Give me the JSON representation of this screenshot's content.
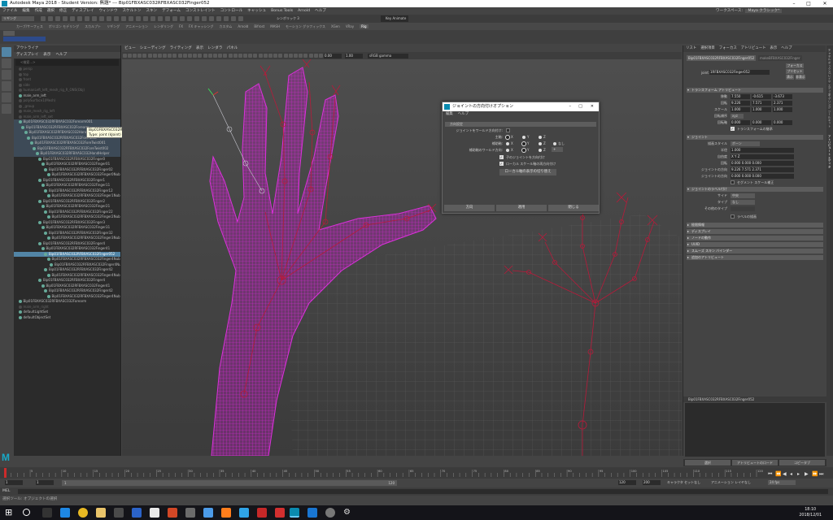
{
  "window": {
    "title": "Autodesk Maya 2018 - Student Version: 無題* --- Bip01FBXASC032RFBXASC032Finger052",
    "controls": [
      "–",
      "□",
      "✕"
    ]
  },
  "menubar": [
    "ファイル",
    "編集",
    "作成",
    "選択",
    "修正",
    "ディスプレイ",
    "ウィンドウ",
    "スケルトン",
    "スキン",
    "デフォーム",
    "コンストレイント",
    "コントロール",
    "キャッシュ",
    "Bonus Tools",
    "Arnold",
    "ヘルプ"
  ],
  "workspace": {
    "label": "ワークスペース:",
    "value": "Maya クラシック*"
  },
  "mode_dropdown": "リギング",
  "toolbar": {
    "live_surface": "シンボリック 3",
    "key_anim": "Key Animate"
  },
  "shelf_tabs": [
    "カーブ/サーフェス",
    "ポリゴン モデリング",
    "スカルプト",
    "リギング",
    "アニメーション",
    "レンダリング",
    "FX",
    "FX キャッシング",
    "カスタム",
    "Arnold",
    "Bifrost",
    "MASH",
    "モーション グラフィックス",
    "XGen",
    "VRay",
    "Rig"
  ],
  "outliner": {
    "title": "アウトライナ",
    "menu": [
      "ディスプレイ",
      "表示",
      "ヘルプ"
    ],
    "search_placeholder": "<検索...>",
    "items": [
      {
        "label": "persp",
        "depth": 1,
        "state": "dim"
      },
      {
        "label": "top",
        "depth": 1,
        "state": "dim"
      },
      {
        "label": "front",
        "depth": 1,
        "state": "dim"
      },
      {
        "label": "side",
        "depth": 1,
        "state": "dim"
      },
      {
        "label": "humanLeft_left_mesh_rig_R_ONS(Obj)",
        "depth": 1,
        "state": "dim"
      },
      {
        "label": "male_arm_left",
        "depth": 1,
        "state": "normal"
      },
      {
        "label": "polySurface1(Mesh)",
        "depth": 1,
        "state": "dim"
      },
      {
        "label": "_group",
        "depth": 1,
        "state": "dim"
      },
      {
        "label": "male_mesh_rig_left",
        "depth": 1,
        "state": "dim"
      },
      {
        "label": "male_arm_left_set",
        "depth": 1,
        "state": "dim"
      },
      {
        "label": "Bip01FBXASC032RFBXASC032Forearm001",
        "depth": 1,
        "state": "hl"
      },
      {
        "label": "Bip01FBXASC032RFBXASC032Forearm",
        "depth": 2,
        "state": "hl"
      },
      {
        "label": "Bip01FBXASC032RFBXASC032Hand",
        "depth": 3,
        "state": "hl"
      },
      {
        "label": "Bip01FBXASC032RFBXASC032ForeTwist",
        "depth": 4,
        "state": "hl"
      },
      {
        "label": "Bip01FBXASC032RFBXASC032ForeTwist001",
        "depth": 5,
        "state": "hl"
      },
      {
        "label": "Bip01FBXASC032RFBXASC032ForeTwist002",
        "depth": 6,
        "state": "hl"
      },
      {
        "label": "Bip01FBXASC032RFBXASC032HandHelper",
        "depth": 7,
        "state": "hl"
      },
      {
        "label": "Bip01FBXASC032RFBXASC032Finger0",
        "depth": 8,
        "state": "normal"
      },
      {
        "label": "Bip01FBXASC032RFBXASC032Finger01",
        "depth": 9,
        "state": "normal"
      },
      {
        "label": "Bip01FBXASC032RFBXASC032Finger02",
        "depth": 10,
        "state": "normal"
      },
      {
        "label": "Bip01FBXASC032RFBXASC032Finger0Nub",
        "depth": 11,
        "state": "normal"
      },
      {
        "label": "Bip01FBXASC032RFBXASC032Finger1",
        "depth": 8,
        "state": "normal"
      },
      {
        "label": "Bip01FBXASC032RFBXASC032Finger11",
        "depth": 9,
        "state": "normal"
      },
      {
        "label": "Bip01FBXASC032RFBXASC032Finger12",
        "depth": 10,
        "state": "normal"
      },
      {
        "label": "Bip01FBXASC032RFBXASC032Finger1Nub",
        "depth": 11,
        "state": "normal"
      },
      {
        "label": "Bip01FBXASC032RFBXASC032Finger2",
        "depth": 8,
        "state": "normal"
      },
      {
        "label": "Bip01FBXASC032RFBXASC032Finger21",
        "depth": 9,
        "state": "normal"
      },
      {
        "label": "Bip01FBXASC032RFBXASC032Finger22",
        "depth": 10,
        "state": "normal"
      },
      {
        "label": "Bip01FBXASC032RFBXASC032Finger2Nub",
        "depth": 11,
        "state": "normal"
      },
      {
        "label": "Bip01FBXASC032RFBXASC032Finger3",
        "depth": 8,
        "state": "normal"
      },
      {
        "label": "Bip01FBXASC032RFBXASC032Finger31",
        "depth": 9,
        "state": "normal"
      },
      {
        "label": "Bip01FBXASC032RFBXASC032Finger32",
        "depth": 10,
        "state": "normal"
      },
      {
        "label": "Bip01FBXASC032RFBXASC032Finger3Nub",
        "depth": 11,
        "state": "normal"
      },
      {
        "label": "Bip01FBXASC032RFBXASC032Finger4",
        "depth": 8,
        "state": "normal"
      },
      {
        "label": "Bip01FBXASC032RFBXASC032Finger41",
        "depth": 9,
        "state": "normal"
      },
      {
        "label": "Bip01FBXASC032RFBXASC032Finger052",
        "depth": 10,
        "state": "sel"
      },
      {
        "label": "Bip01FBXASC032RFBXASC032Finger4Nub",
        "depth": 11,
        "state": "normal"
      },
      {
        "label": "Bip01FBXASC032RFBXASC032Finger4Nub",
        "depth": 12,
        "state": "normal"
      },
      {
        "label": "Bip01FBXASC032RFBXASC032Finger42",
        "depth": 10,
        "state": "normal"
      },
      {
        "label": "Bip01FBXASC032RFBXASC032Finger4Nub",
        "depth": 11,
        "state": "normal"
      },
      {
        "label": "Bip01FBXASC032RFBXASC032Finger4",
        "depth": 8,
        "state": "normal"
      },
      {
        "label": "Bip01FBXASC032RFBXASC032Finger41",
        "depth": 9,
        "state": "normal"
      },
      {
        "label": "Bip01FBXASC032RFBXASC032Finger42",
        "depth": 10,
        "state": "normal"
      },
      {
        "label": "Bip01FBXASC032RFBXASC032Finger4Nub",
        "depth": 11,
        "state": "normal"
      },
      {
        "label": "Bip01FBXASC032RFBXASC032Forearm",
        "depth": 1,
        "state": "normal"
      },
      {
        "label": "male_arm_right",
        "depth": 1,
        "state": "dim"
      },
      {
        "label": "defaultLightSet",
        "depth": 1,
        "state": "normal"
      },
      {
        "label": "defaultObjectSet",
        "depth": 1,
        "state": "normal"
      }
    ],
    "tooltip": {
      "line1": "Bip01FBXASC032RFBXASC032Forearm001",
      "line2": "Type: joint (kJoint)"
    }
  },
  "viewport": {
    "menu": [
      "ビュー",
      "シェーディング",
      "ライティング",
      "表示",
      "レンダラ",
      "パネル"
    ],
    "fields": [
      "0.00",
      "1.00"
    ],
    "color_space": "sRGB gamma",
    "camera_label": "persp"
  },
  "dialog": {
    "title": "ジョイントの方向付けオプション",
    "controls": [
      "–",
      "□",
      "✕"
    ],
    "menu": [
      "編集",
      "ヘルプ"
    ],
    "section": "方向設定",
    "rows": [
      {
        "label": "ジョイントをワールド方向付け:",
        "type": "check"
      },
      {
        "label": "主軸:",
        "options": [
          "X",
          "Y",
          "Z"
        ],
        "selected": 0
      },
      {
        "label": "補助軸:",
        "options": [
          "X",
          "Y",
          "Z",
          "なし"
        ],
        "selected": 1
      },
      {
        "label": "補助軸のワールド方向:",
        "options": [
          "X",
          "Y",
          "Z"
        ],
        "selected": 1,
        "extra": "+"
      }
    ],
    "checks": [
      "子のジョイントを方向付け",
      "ローカル スケール軸の再方向付け"
    ],
    "toggle_button": "ローカル軸の表示の切り替え",
    "buttons": [
      "方向",
      "適用",
      "閉じる"
    ]
  },
  "attribute_editor": {
    "tabs": [
      "リスト",
      "選択項目",
      "フォーカス",
      "アトリビュート",
      "表示",
      "ヘルプ"
    ],
    "node_tabs": [
      "Bip01FBXASC032RFBXASC032Finger052",
      "makeBFBXASC032Finger"
    ],
    "joint_label": "joint:",
    "joint_name": "1RFBXASC032Finger052",
    "side_buttons": [
      "フォーカス",
      "プリセット",
      "表示",
      "非表示"
    ],
    "sections": {
      "transform": "トランスフォーム アトリビュート",
      "joint": "ジョイント",
      "joint_label_sec": "ジョイントのラベル付け",
      "collapsed": [
        "極限情報",
        "ディスプレイ",
        "ノードの動作",
        "UUID",
        "スムーズ スキン バインダー",
        "追加のアトリビュート"
      ]
    },
    "transform_rows": [
      {
        "label": "移動",
        "values": [
          "7.550",
          "-0.615",
          "-3.673"
        ]
      },
      {
        "label": "回転",
        "values": [
          "9.226",
          "7.571",
          "2.371"
        ]
      },
      {
        "label": "スケール",
        "values": [
          "1.000",
          "1.000",
          "1.000"
        ]
      },
      {
        "label": "回転順序",
        "values": [
          "xyz"
        ]
      },
      {
        "label": "回転軸",
        "values": [
          "0.000",
          "0.000",
          "0.000"
        ]
      }
    ],
    "inherits": "トランスフォームの継承",
    "joint_rows": [
      {
        "label": "描画スタイル",
        "value": "ボーン"
      },
      {
        "label": "半径",
        "value": "1.000"
      },
      {
        "label": "自由度",
        "value": "X  Y  Z"
      },
      {
        "label": "回転",
        "value": "0.000  0.000  0.000"
      },
      {
        "label": "ジョイントの方向",
        "value": "9.226  7.571  2.371"
      },
      {
        "label": "ジョイントの方向",
        "value": "0.000  0.000  0.000"
      }
    ],
    "segment_scale": "セグメント スケール補正",
    "label_rows": [
      {
        "label": "サイド",
        "value": "中央"
      },
      {
        "label": "タイプ",
        "value": "なし"
      },
      {
        "label": "その他のタイプ",
        "value": ""
      }
    ],
    "draw_label": "ラベルの描画",
    "notes_title": "Bip01FBXASC032RFBXASC032Finger052",
    "bottom_buttons": [
      "選択",
      "アトリビュートのロード",
      "コピータブ"
    ]
  },
  "right_tabs": [
    "チャネル ボックス/レイヤ エディタ",
    "モデリング ツールキット",
    "アトリビュート エディタ"
  ],
  "timeline": {
    "ticks": [
      "5",
      "10",
      "15",
      "20",
      "25",
      "30",
      "35",
      "40",
      "45",
      "50",
      "55",
      "60",
      "65",
      "70",
      "75",
      "80",
      "85",
      "90",
      "95",
      "100",
      "105",
      "110",
      "115",
      "120"
    ],
    "current": "1"
  },
  "range": {
    "start": "1",
    "start2": "1",
    "slider_start": "1",
    "slider_end": "120",
    "end": "120",
    "end2": "200",
    "character": "キャラクタ セットなし",
    "anim_layer": "アニメーション レイヤなし",
    "fps": "24 fps"
  },
  "cmdline": {
    "label": "MEL"
  },
  "helpline": "選択ツール: オブジェクトの選択",
  "clock": {
    "time": "18:10",
    "date": "2018/12/01"
  },
  "colors": {
    "mesh": "#cc22cc",
    "joint": "#b81a3a",
    "selection": "#5285a6",
    "grid": "#5a5a5a"
  }
}
